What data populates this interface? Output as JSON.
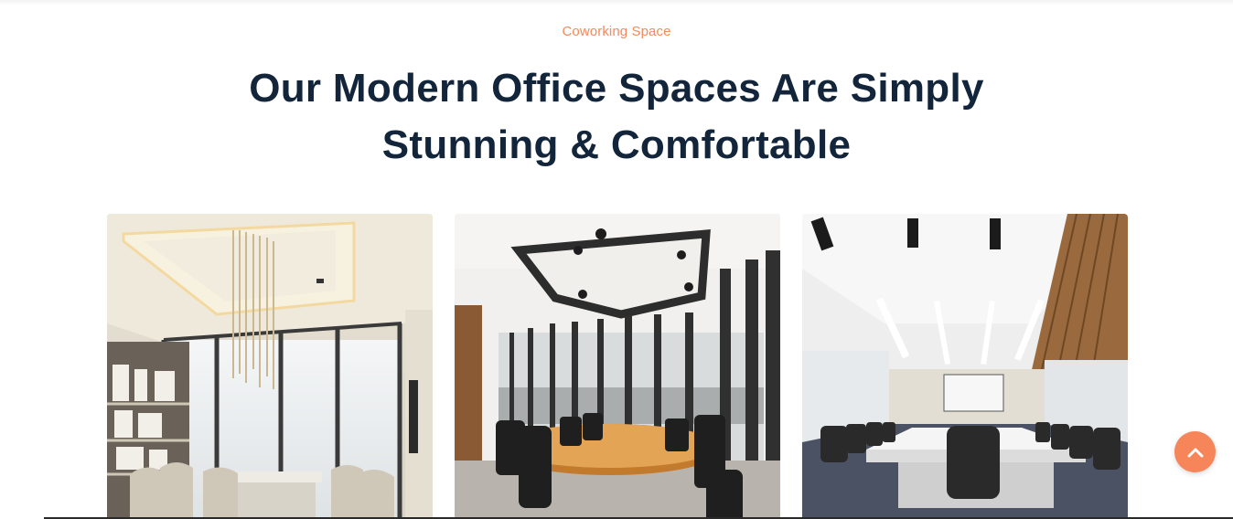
{
  "section": {
    "eyebrow": "Coworking Space",
    "title_line1": "Our Modern Office Spaces Are Simply",
    "title_line2": "Stunning & Comfortable"
  },
  "gallery": [
    {
      "name": "meeting-room-light"
    },
    {
      "name": "boardroom-dark-slats"
    },
    {
      "name": "conference-hall-long-table"
    }
  ],
  "colors": {
    "accent": "#f6855a",
    "eyebrow": "#f28a5c",
    "heading": "#13253b"
  },
  "icons": {
    "scroll_top": "chevron-up-icon"
  }
}
